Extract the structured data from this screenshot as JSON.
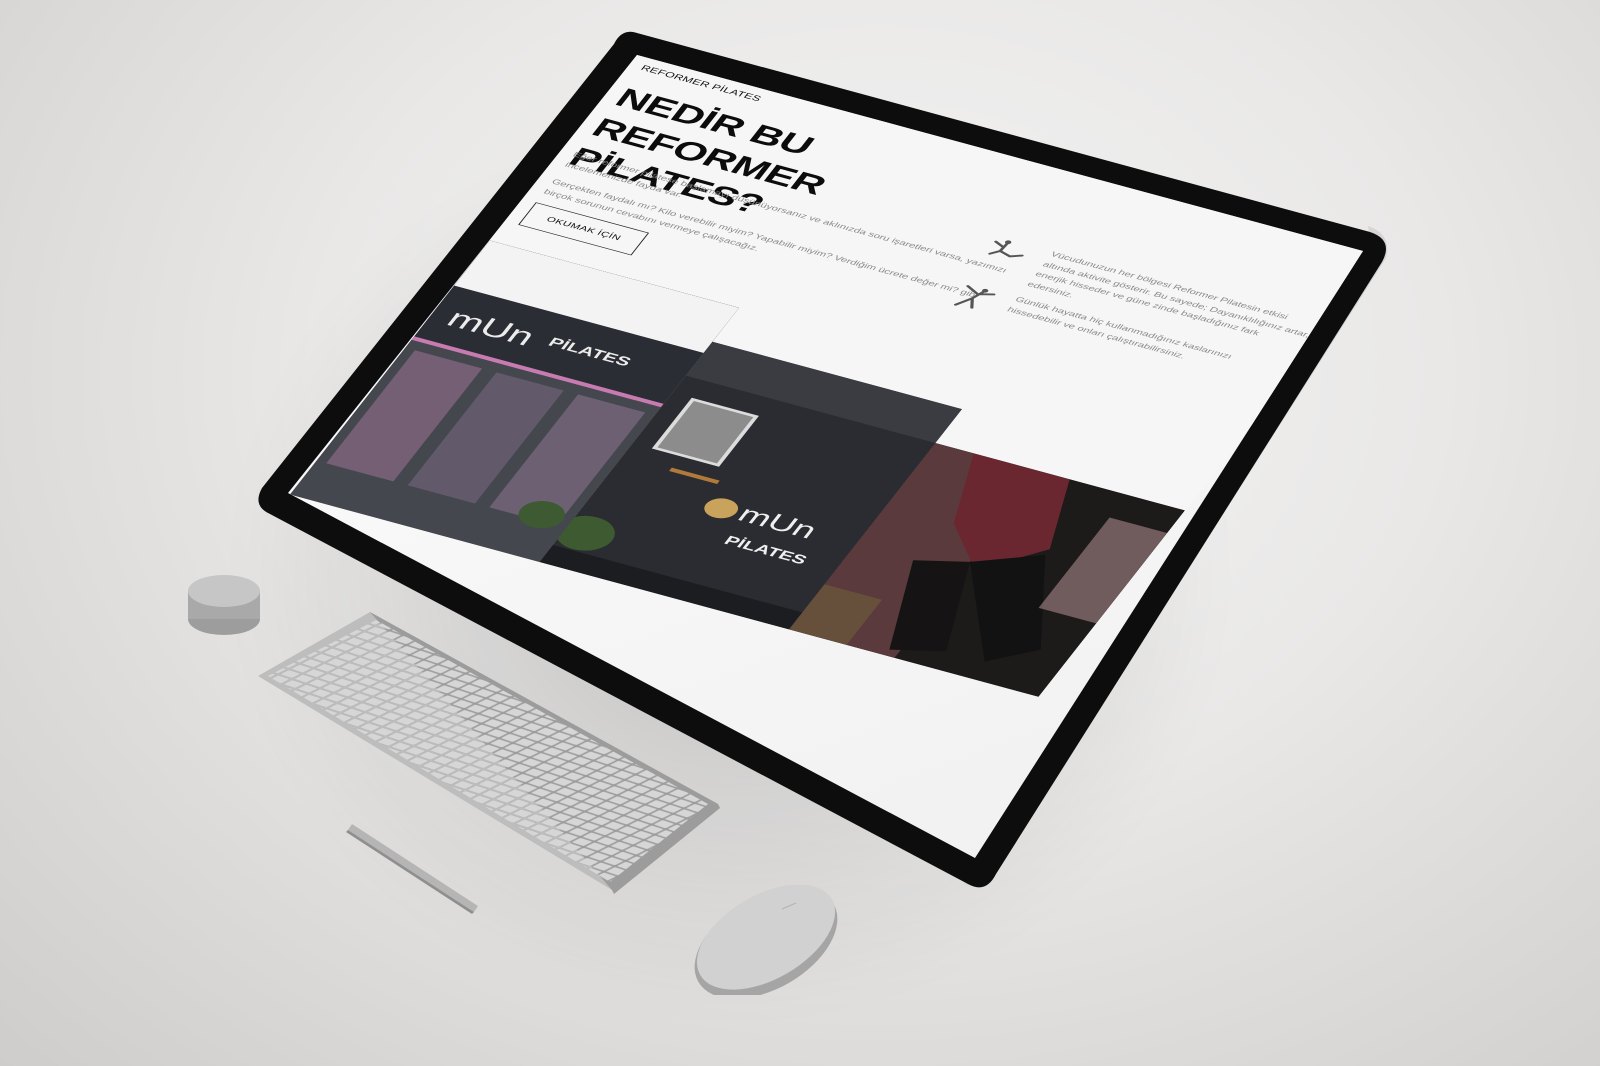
{
  "page": {
    "section_label": "REFORMER PİLATES",
    "hero_title": [
      "NEDİR BU REFORMER",
      "PİLATES?"
    ],
    "intro_paragraphs": [
      "Eğer reformer pilatese başlamayı düşünüyorsanız ve aklınızda soru işaretleri varsa, yazımızı incelemenizde fayda var.",
      "Gerçekten faydalı mı? Kilo verebilir miyim? Yapabilir miyim? Verdiğim ücrete değer mi? gibi birçok sorunun cevabını vermeye çalışacağız."
    ],
    "read_button": "OKUMAK İÇİN",
    "features": [
      {
        "icon": "yoga-pose-icon",
        "text": "Vücudunuzun her bölgesi Reformer Pilatesin etkisi altında aktivite gösterir. Bu sayede; Dayanıklılığınız artar, enerjik hisseder ve güne zinde başladığınız fark edersiniz."
      },
      {
        "icon": "dancer-pose-icon",
        "text": "Günlük hayatta hiç kullanmadığınız kaslarınızı hissedebilir ve onları çalıştırabilirsiniz."
      }
    ],
    "gallery": {
      "sign_text_1": "mUn",
      "sign_text_2": "PİLATES",
      "sign_text_3": "mUn",
      "sign_text_4": "PİLATES"
    }
  },
  "colors": {
    "bezel": "#0d0d0d",
    "page_bg": "#f6f6f6",
    "title": "#0c0c0c",
    "body_text": "#8a8a8a",
    "device_gray": "#c9c9c9"
  }
}
